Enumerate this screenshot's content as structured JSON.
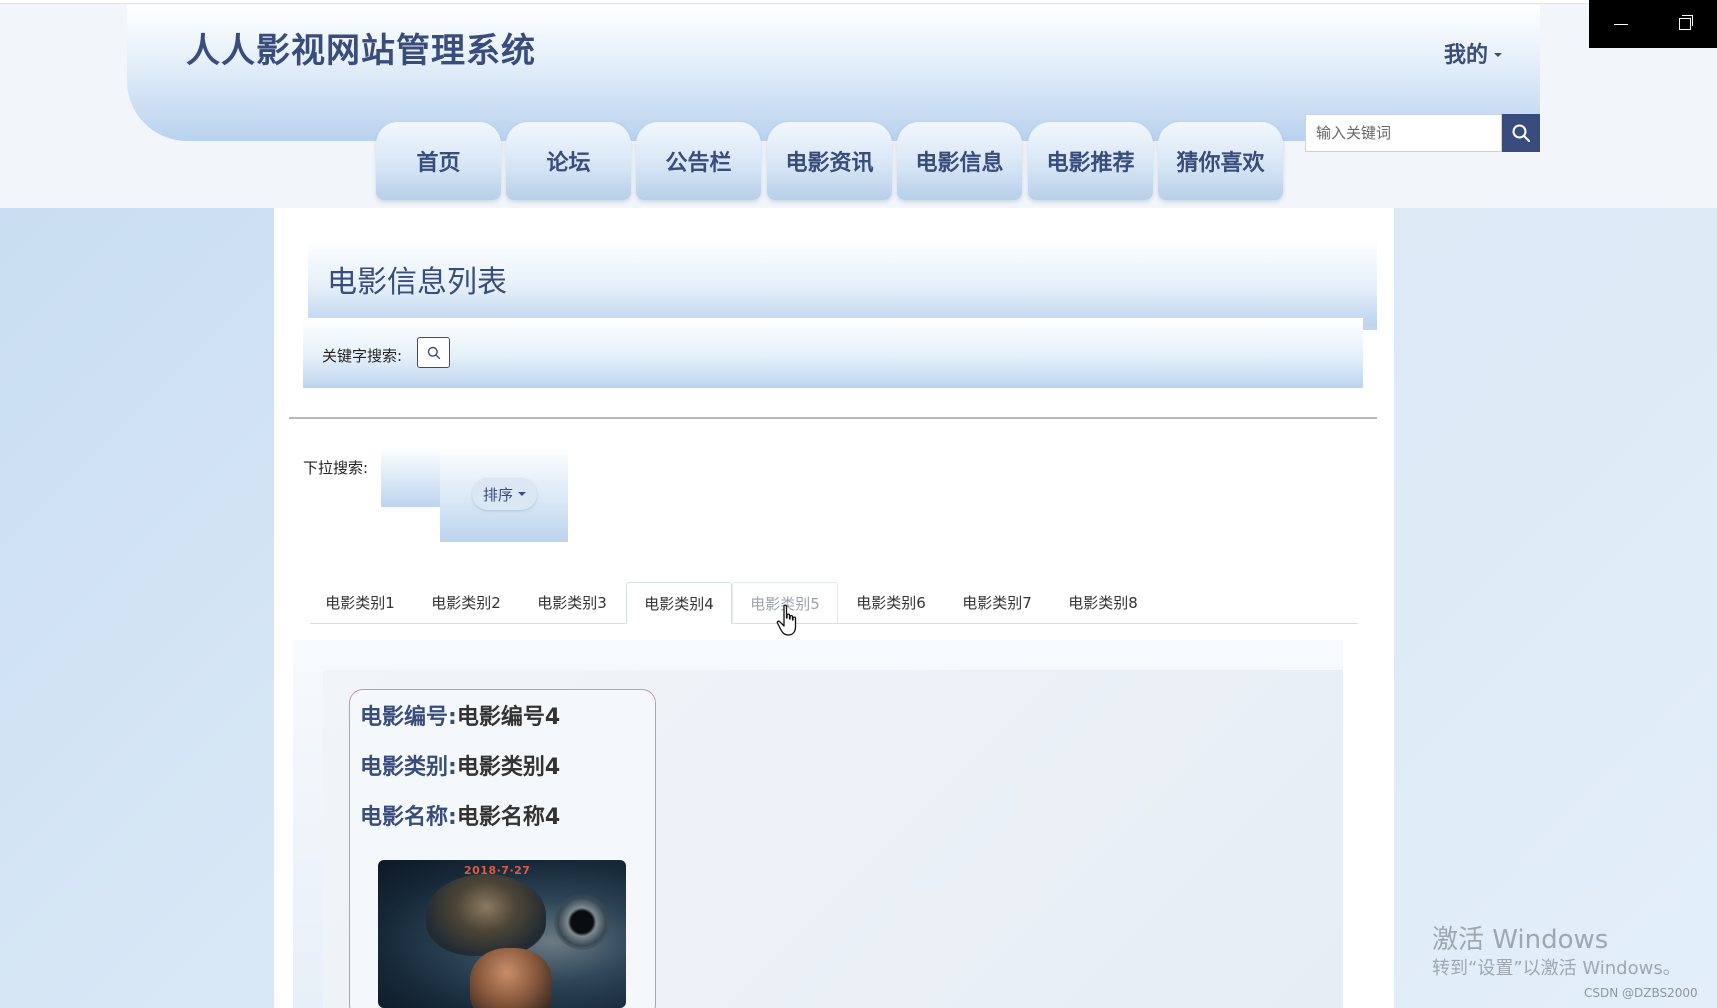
{
  "header": {
    "site_title": "人人影视网站管理系统",
    "my_menu_label": "我的"
  },
  "nav": {
    "items": [
      "首页",
      "论坛",
      "公告栏",
      "电影资讯",
      "电影信息",
      "电影推荐",
      "猜你喜欢"
    ]
  },
  "search": {
    "placeholder": "输入关键词"
  },
  "page": {
    "title": "电影信息列表",
    "keyword_search_label": "关键字搜索:",
    "dropdown_search_label": "下拉搜索:",
    "sort_label": "排序"
  },
  "tabs": {
    "items": [
      "电影类别1",
      "电影类别2",
      "电影类别3",
      "电影类别4",
      "电影类别5",
      "电影类别6",
      "电影类别7",
      "电影类别8"
    ],
    "active_index": 3,
    "hover_index": 4
  },
  "movie_card": {
    "fields": [
      {
        "key": "电影编号:",
        "value": "电影编号4"
      },
      {
        "key": "电影类别:",
        "value": "电影类别4"
      },
      {
        "key": "电影名称:",
        "value": "电影名称4"
      }
    ],
    "poster": {
      "date_text": "2018·7·27"
    }
  },
  "watermark": {
    "line1": "激活 Windows",
    "line2": "转到“设置”以激活 Windows。"
  },
  "csdn_mark": "CSDN @DZBS2000",
  "colors": {
    "primary": "#3a4c7c",
    "gradient_light": "#e6f0fa",
    "gradient_dark": "#bcd4ee"
  }
}
